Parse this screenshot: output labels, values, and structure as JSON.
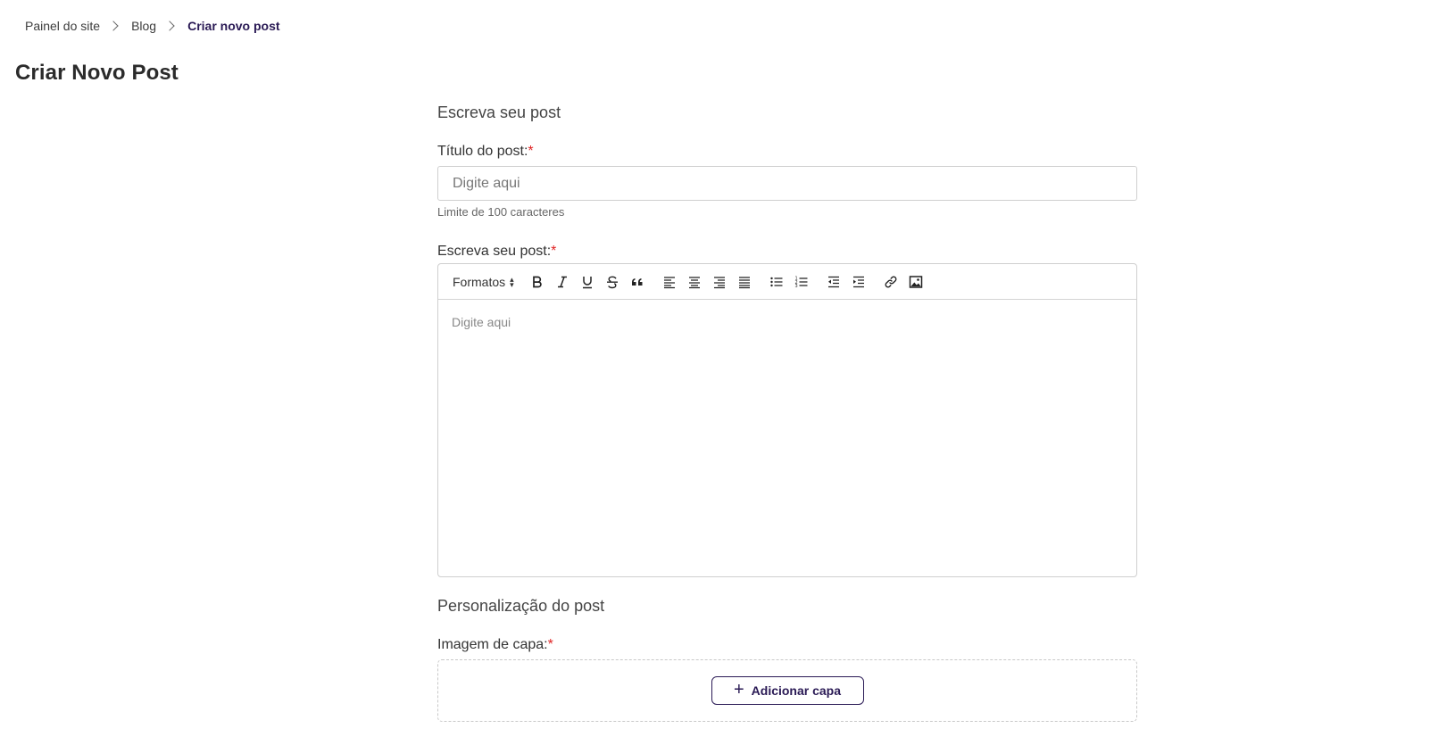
{
  "breadcrumb": {
    "items": [
      {
        "label": "Painel do site"
      },
      {
        "label": "Blog"
      },
      {
        "label": "Criar novo post"
      }
    ]
  },
  "page": {
    "title": "Criar Novo Post"
  },
  "write_section": {
    "title": "Escreva seu post",
    "title_field": {
      "label": "Título do post:",
      "required_mark": "*",
      "placeholder": "Digite aqui",
      "value": "",
      "hint": "Limite de 100 caracteres"
    },
    "content_field": {
      "label": "Escreva seu post:",
      "required_mark": "*",
      "placeholder": "Digite aqui",
      "toolbar": {
        "formats_label": "Formatos",
        "buttons": [
          "bold-icon",
          "italic-icon",
          "underline-icon",
          "strikethrough-icon",
          "quote-icon",
          "align-left-icon",
          "align-center-icon",
          "align-right-icon",
          "align-justify-icon",
          "bullet-list-icon",
          "numbered-list-icon",
          "outdent-icon",
          "indent-icon",
          "link-icon",
          "image-icon"
        ]
      }
    }
  },
  "customize_section": {
    "title": "Personalização do post",
    "cover_field": {
      "label": "Imagem de capa:",
      "required_mark": "*",
      "button_label": "Adicionar capa"
    }
  },
  "colors": {
    "primary": "#2a1a55",
    "required": "#e02424",
    "border": "#cfcfcf"
  }
}
